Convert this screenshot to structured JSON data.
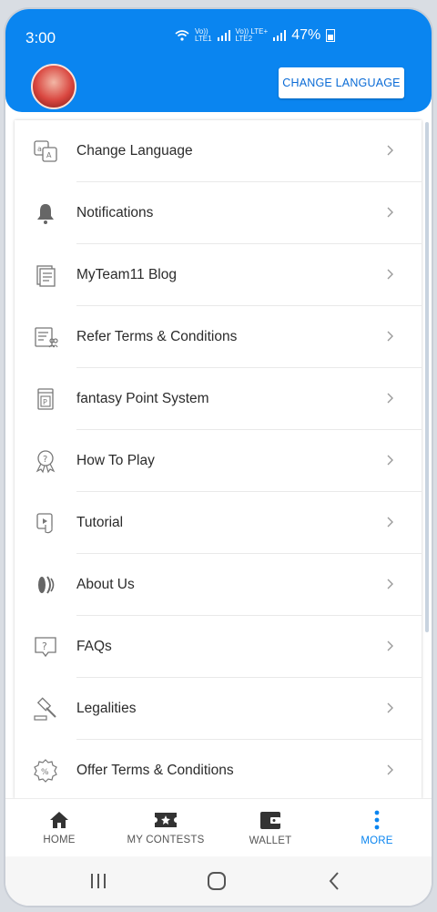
{
  "status_bar": {
    "time": "3:00",
    "net1_top": "Vo))",
    "net1_bottom": "LTE1",
    "net2_top": "Vo)) LTE+",
    "net2_bottom": "LTE2",
    "battery": "47%"
  },
  "header": {
    "change_language_button": "CHANGE LANGUAGE",
    "brand_color": "#0a85f0"
  },
  "menu": {
    "items": [
      {
        "label": "Change Language",
        "icon": "translate-icon"
      },
      {
        "label": "Notifications",
        "icon": "bell-icon"
      },
      {
        "label": "MyTeam11 Blog",
        "icon": "blog-icon"
      },
      {
        "label": "Refer Terms & Conditions",
        "icon": "refer-terms-icon"
      },
      {
        "label": "fantasy Point System",
        "icon": "points-icon"
      },
      {
        "label": "How To Play",
        "icon": "award-icon"
      },
      {
        "label": "Tutorial",
        "icon": "tutorial-icon"
      },
      {
        "label": "About Us",
        "icon": "about-icon"
      },
      {
        "label": "FAQs",
        "icon": "faq-icon"
      },
      {
        "label": "Legalities",
        "icon": "gavel-icon"
      },
      {
        "label": "Offer Terms & Conditions",
        "icon": "offer-icon"
      }
    ]
  },
  "bottom_nav": {
    "items": [
      {
        "label": "HOME",
        "icon": "home-icon"
      },
      {
        "label": "MY CONTESTS",
        "icon": "ticket-icon"
      },
      {
        "label": "WALLET",
        "icon": "wallet-icon"
      },
      {
        "label": "MORE",
        "icon": "more-icon",
        "active": true
      }
    ]
  },
  "system_nav": [
    "recent-apps-icon",
    "home-circle-icon",
    "back-icon"
  ]
}
